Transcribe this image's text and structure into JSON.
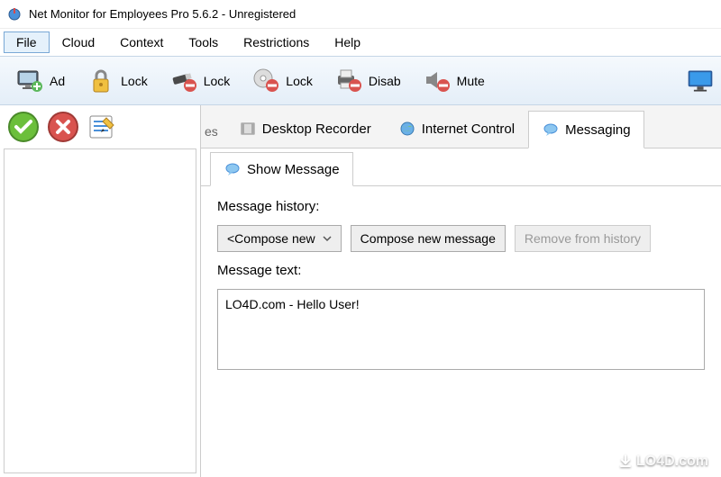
{
  "window": {
    "title": "Net Monitor for Employees Pro 5.6.2 - Unregistered"
  },
  "menubar": {
    "file": "File",
    "cloud": "Cloud",
    "context": "Context",
    "tools": "Tools",
    "restrictions": "Restrictions",
    "help": "Help"
  },
  "toolbar": {
    "add": "Ad",
    "lock1": "Lock",
    "lock2": "Lock",
    "lock3": "Lock",
    "disable": "Disab",
    "mute": "Mute"
  },
  "tabs": {
    "partial": "es",
    "desktop_recorder": "Desktop Recorder",
    "internet_control": "Internet Control",
    "messaging": "Messaging"
  },
  "subtab": {
    "show_message": "Show Message"
  },
  "messaging": {
    "history_label": "Message history:",
    "compose_dropdown": "<Compose new",
    "compose_btn": "Compose new message",
    "remove_btn": "Remove from history",
    "text_label": "Message text:",
    "text_value": "LO4D.com - Hello User!"
  },
  "watermark": "LO4D.com"
}
